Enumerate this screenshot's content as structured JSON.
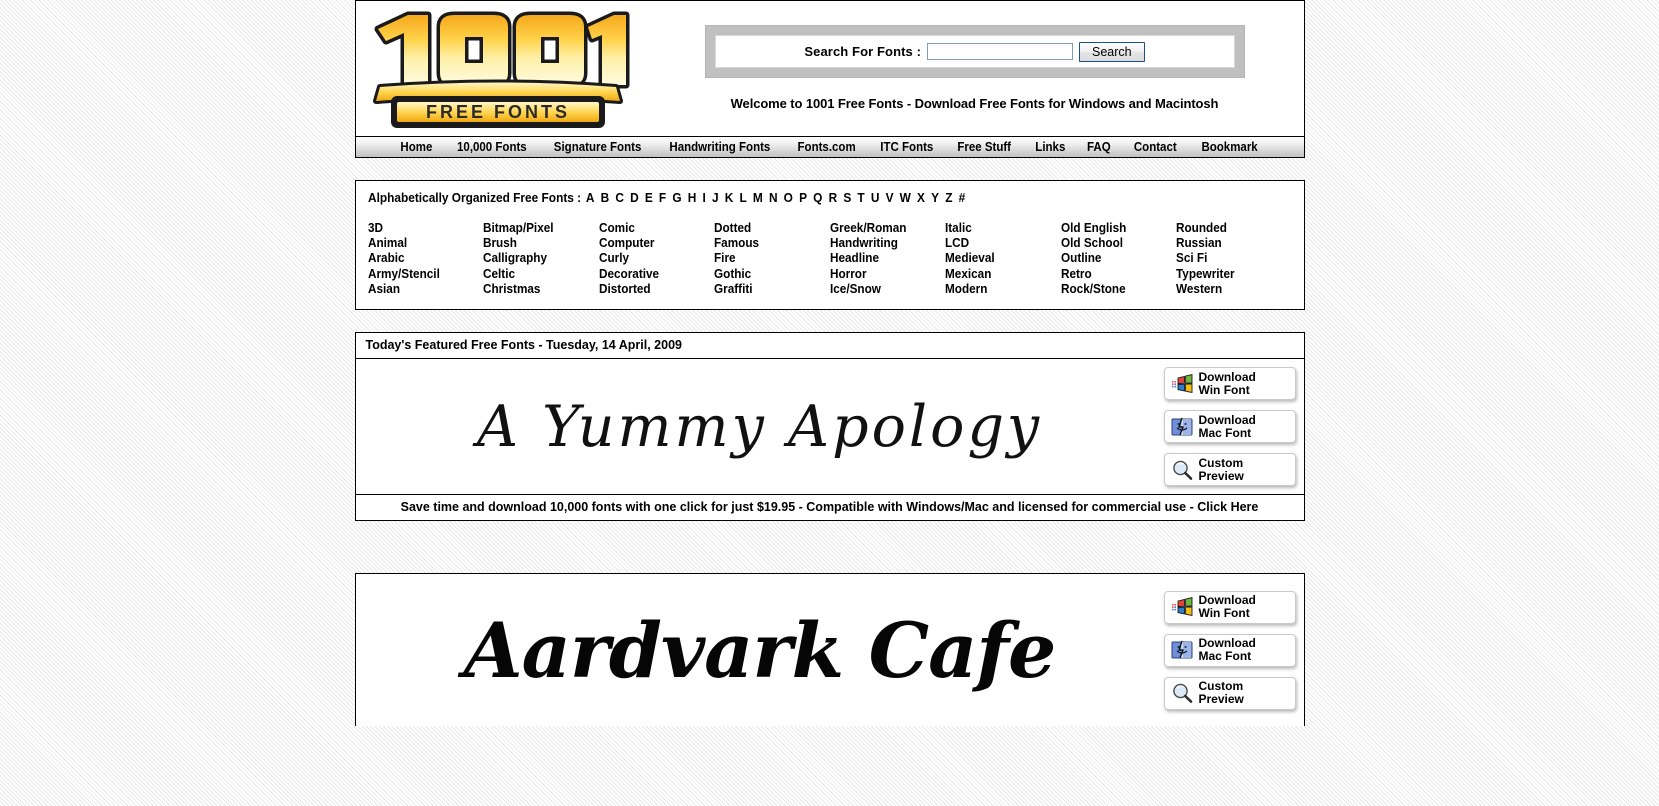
{
  "site": {
    "logo_line1": "1001",
    "logo_line2": "FREE FONTS"
  },
  "search": {
    "label": "Search For Fonts :",
    "value": "",
    "placeholder": "",
    "button_label": "Search"
  },
  "welcome": "Welcome to 1001 Free Fonts - Download Free Fonts for Windows and Macintosh",
  "nav": {
    "items": [
      "Home",
      "10,000 Fonts",
      "Signature Fonts",
      "Handwriting Fonts",
      "Fonts.com",
      "ITC Fonts",
      "Free Stuff",
      "Links",
      "FAQ",
      "Contact",
      "Bookmark"
    ]
  },
  "alphabet": {
    "label": "Alphabetically Organized Free Fonts :",
    "letters": [
      "A",
      "B",
      "C",
      "D",
      "E",
      "F",
      "G",
      "H",
      "I",
      "J",
      "K",
      "L",
      "M",
      "N",
      "O",
      "P",
      "Q",
      "R",
      "S",
      "T",
      "U",
      "V",
      "W",
      "X",
      "Y",
      "Z",
      "#"
    ]
  },
  "categories": {
    "columns": [
      [
        "3D",
        "Animal",
        "Arabic",
        "Army/Stencil",
        "Asian"
      ],
      [
        "Bitmap/Pixel",
        "Brush",
        "Calligraphy",
        "Celtic",
        "Christmas"
      ],
      [
        "Comic",
        "Computer",
        "Curly",
        "Decorative",
        "Distorted"
      ],
      [
        "Dotted",
        "Famous",
        "Fire",
        "Gothic",
        "Graffiti"
      ],
      [
        "Greek/Roman",
        "Handwriting",
        "Headline",
        "Horror",
        "Ice/Snow"
      ],
      [
        "Italic",
        "LCD",
        "Medieval",
        "Mexican",
        "Modern"
      ],
      [
        "Old English",
        "Old School",
        "Outline",
        "Retro",
        "Rock/Stone"
      ],
      [
        "Rounded",
        "Russian",
        "Sci Fi",
        "Typewriter",
        "Western"
      ]
    ]
  },
  "featured": {
    "header": "Today's Featured Free Fonts - Tuesday, 14 April, 2009",
    "fonts": [
      {
        "name": "A Yummy Apology"
      },
      {
        "name": "Aardvark Cafe"
      }
    ],
    "buttons": {
      "win_line1": "Download",
      "win_line2": "Win Font",
      "mac_line1": "Download",
      "mac_line2": "Mac Font",
      "preview_line1": "Custom",
      "preview_line2": "Preview"
    }
  },
  "promo": {
    "text": "Save time and download 10,000 fonts with one click for just $19.95 - Compatible with Windows/Mac and licensed for commercial use - ",
    "link": "Click Here"
  },
  "colors": {
    "logo_gold": "#F2B422",
    "logo_gold_light": "#FCDF7A",
    "nav_gradient_top": "#FDFDFD",
    "nav_gradient_bottom": "#C2C2C2",
    "search_panel": "#C0C0C0",
    "border": "#000000"
  }
}
